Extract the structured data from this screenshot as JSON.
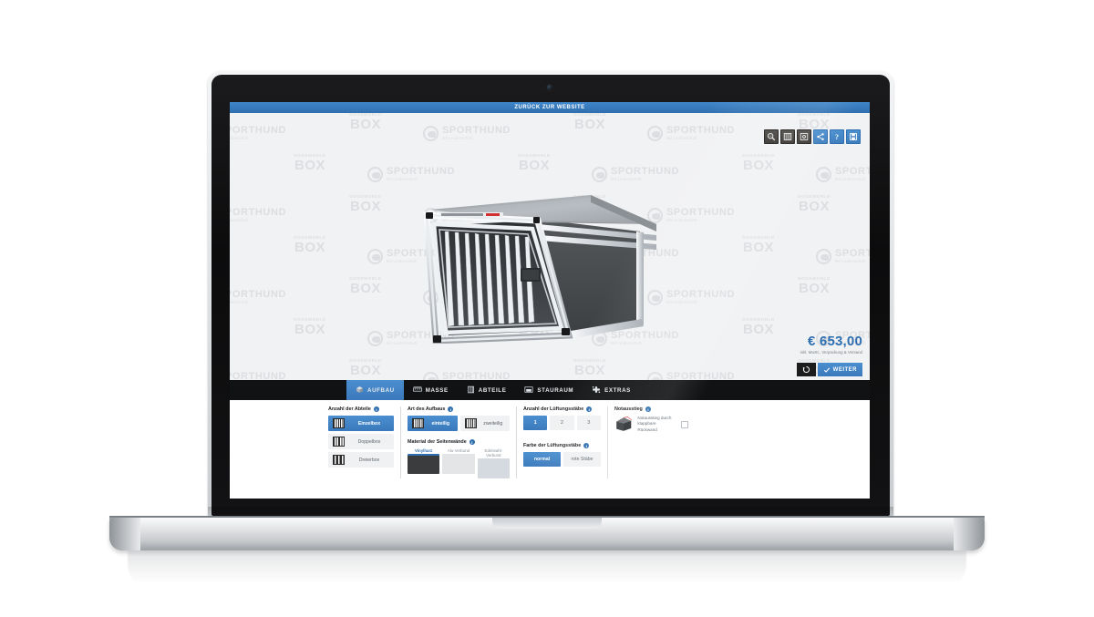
{
  "app": {
    "back_link": "ZURÜCK ZUR WEBSITE",
    "accent": "#2f6fb0",
    "dark": "#111214"
  },
  "watermark": {
    "brand": "SPORTHUND",
    "tagline": "Mit Leidenschaft",
    "sub_brand_top": "DOGSWORLD",
    "sub_brand_bottom": "BOX"
  },
  "toolbar": {
    "items": [
      {
        "name": "zoom-icon",
        "title": "Zoom",
        "style": "dark"
      },
      {
        "name": "bars-view-icon",
        "title": "Gitter",
        "style": "dark"
      },
      {
        "name": "target-icon",
        "title": "Ansicht",
        "style": "dark"
      },
      {
        "name": "share-icon",
        "title": "Teilen",
        "style": "blue"
      },
      {
        "name": "help-icon",
        "title": "?",
        "style": "blue"
      },
      {
        "name": "save-icon",
        "title": "Speichern",
        "style": "blue"
      }
    ],
    "help_label": "?"
  },
  "price": {
    "amount": "€ 653,00",
    "note": "inkl. MwSt., Verpackung & Versand",
    "reset_label": "↺",
    "next_label": "WEITER"
  },
  "tabs": [
    {
      "label": "AUFBAU",
      "icon": "cube-icon",
      "active": true
    },
    {
      "label": "MASSE",
      "icon": "ruler-icon",
      "active": false
    },
    {
      "label": "ABTEILE",
      "icon": "grid-icon",
      "active": false
    },
    {
      "label": "STAURAUM",
      "icon": "drawer-icon",
      "active": false
    },
    {
      "label": "EXTRAS",
      "icon": "plus-parts-icon",
      "active": false
    }
  ],
  "options": {
    "compartments": {
      "title": "Anzahl der Abteile",
      "items": [
        {
          "label": "Einzelbox",
          "segments": 1,
          "selected": true
        },
        {
          "label": "Doppelbox",
          "segments": 2,
          "selected": false
        },
        {
          "label": "Dreierbox",
          "segments": 3,
          "selected": false
        }
      ]
    },
    "build_type": {
      "title": "Art des Aufbaus",
      "items": [
        {
          "label": "einteilig",
          "selected": true
        },
        {
          "label": "zweiteilig",
          "selected": false
        }
      ]
    },
    "side_material": {
      "title": "Material der Seitenwände",
      "items": [
        {
          "label": "Vinylharz",
          "color": "#3b3c3e",
          "selected": true
        },
        {
          "label": "Alu-Verbund",
          "color": "#e3e5e7",
          "selected": false
        },
        {
          "label": "Edelstahl-Verbund",
          "color": "#d5dae0",
          "selected": false
        }
      ]
    },
    "bar_count": {
      "title": "Anzahl der Lüftungsstäbe",
      "items": [
        {
          "label": "1",
          "selected": true
        },
        {
          "label": "2",
          "selected": false
        },
        {
          "label": "3",
          "selected": false
        }
      ]
    },
    "bar_color": {
      "title": "Farbe der Lüftungsstäbe",
      "items": [
        {
          "label": "normal",
          "selected": true
        },
        {
          "label": "rote Stäbe",
          "selected": false
        }
      ]
    },
    "emergency_exit": {
      "title": "Notausstieg",
      "label": "Notausstieg durch klappbare Rückwand",
      "checked": false
    }
  }
}
